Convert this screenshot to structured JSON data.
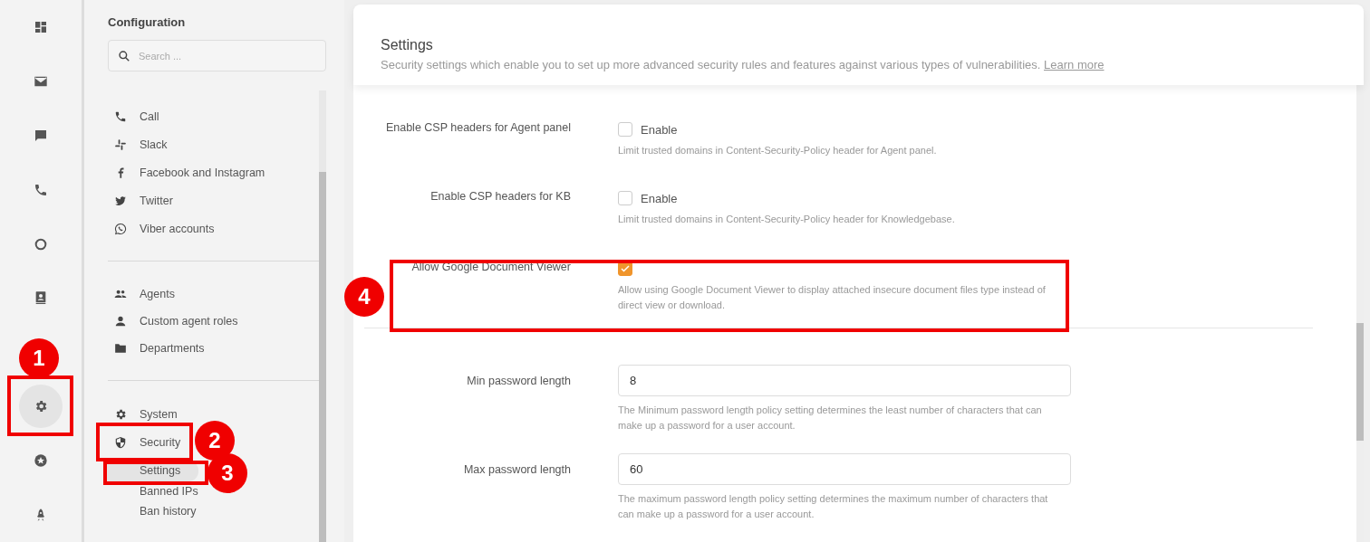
{
  "rail": [
    {
      "selected": false
    },
    {
      "selected": false
    },
    {
      "selected": false
    },
    {
      "selected": false
    },
    {
      "selected": false
    },
    {
      "selected": false
    },
    {
      "selected": true
    },
    {
      "selected": false
    },
    {
      "selected": false
    }
  ],
  "config": {
    "title": "Configuration",
    "search": {
      "placeholder": "Search ..."
    },
    "groups": [
      {
        "items": [
          {
            "label": "Call"
          },
          {
            "label": "Slack"
          },
          {
            "label": "Facebook and Instagram"
          },
          {
            "label": "Twitter"
          },
          {
            "label": "Viber accounts"
          }
        ]
      },
      {
        "items": [
          {
            "label": "Agents"
          },
          {
            "label": "Custom agent roles"
          },
          {
            "label": "Departments"
          }
        ]
      },
      {
        "items": [
          {
            "label": "System"
          },
          {
            "label": "Security",
            "children": [
              {
                "label": "Settings",
                "selected": true
              },
              {
                "label": "Banned IPs",
                "selected": false
              },
              {
                "label": "Ban history",
                "selected": false
              }
            ]
          }
        ]
      }
    ]
  },
  "header": {
    "title": "Settings",
    "description": "Security settings which enable you to set up more advanced security rules and features against various types of vulnerabilities.",
    "link": "Learn more"
  },
  "settings": [
    {
      "kind": "checkbox",
      "label": "Enable CSP headers for Agent panel",
      "option": "Enable",
      "checked": false,
      "hint": "Limit trusted domains in Content-Security-Policy header for Agent panel."
    },
    {
      "kind": "checkbox",
      "label": "Enable CSP headers for KB",
      "option": "Enable",
      "checked": false,
      "hint": "Limit trusted domains in Content-Security-Policy header for Knowledgebase."
    },
    {
      "kind": "checkbox",
      "label": "Allow Google Document Viewer",
      "checked": true,
      "hint": "Allow using Google Document Viewer to display attached insecure document files type instead of direct view or download."
    },
    {
      "kind": "divider"
    },
    {
      "kind": "input",
      "label": "Min password length",
      "value": "8",
      "hint": "The Minimum password length policy setting determines the least number of characters that can make up a password for a user account."
    },
    {
      "kind": "input",
      "label": "Max password length",
      "value": "60",
      "hint": "The maximum password length policy setting determines the maximum number of characters that can make up a password for a user account."
    }
  ],
  "annotations": [
    {
      "number": "1"
    },
    {
      "number": "2"
    },
    {
      "number": "3"
    },
    {
      "number": "4"
    }
  ]
}
